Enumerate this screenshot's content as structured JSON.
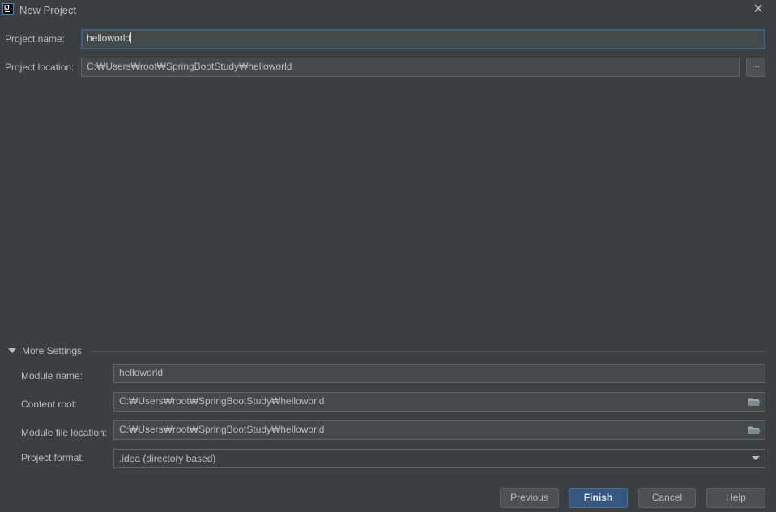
{
  "window": {
    "title": "New Project",
    "app_icon_text": "IJ"
  },
  "form": {
    "project_name_label": "Project name:",
    "project_name_value": "helloworld",
    "project_location_label": "Project location:",
    "project_location_value": "C:₩Users₩root₩SpringBootStudy₩helloworld",
    "browse_label": "..."
  },
  "more_settings": {
    "title": "More Settings",
    "expanded": true,
    "module_name_label": "Module name:",
    "module_name_value": "helloworld",
    "content_root_label": "Content root:",
    "content_root_value": "C:₩Users₩root₩SpringBootStudy₩helloworld",
    "module_file_location_label": "Module file location:",
    "module_file_location_value": "C:₩Users₩root₩SpringBootStudy₩helloworld",
    "project_format_label": "Project format:",
    "project_format_value": ".idea (directory based)"
  },
  "buttons": {
    "previous": "Previous",
    "finish": "Finish",
    "cancel": "Cancel",
    "help": "Help"
  },
  "colors": {
    "background": "#3c3f41",
    "field_background": "#45494a",
    "focus_border": "#3d6185",
    "primary_button": "#365880"
  },
  "icons": {
    "close": "close-icon",
    "browse_folder": "folder-icon",
    "expand": "triangle-down-icon",
    "dropdown": "chevron-down-icon"
  }
}
